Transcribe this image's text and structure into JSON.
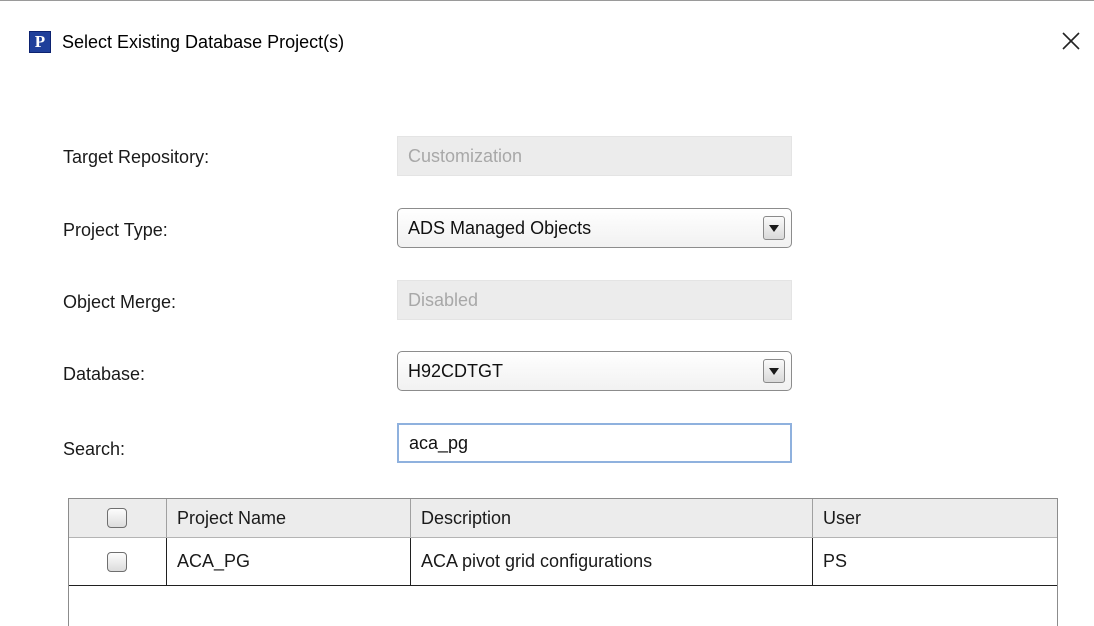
{
  "window": {
    "title": "Select Existing Database Project(s)",
    "icon_letter": "P",
    "icon_name": "peoplesoft-app-icon",
    "close_icon": "close-icon"
  },
  "form": {
    "target_repository": {
      "label": "Target Repository:",
      "value": "Customization"
    },
    "project_type": {
      "label": "Project Type:",
      "value": "ADS Managed Objects"
    },
    "object_merge": {
      "label": "Object Merge:",
      "value": "Disabled"
    },
    "database": {
      "label": "Database:",
      "value": "H92CDTGT"
    },
    "search": {
      "label": "Search:",
      "value": "aca_pg"
    }
  },
  "table": {
    "columns": [
      "",
      "Project Name",
      "Description",
      "User"
    ],
    "rows": [
      {
        "checked": false,
        "project_name": "ACA_PG",
        "description": "ACA pivot grid configurations",
        "user": "PS"
      }
    ]
  },
  "colors": {
    "icon_blue": "#1f3f9a",
    "input_focus_border": "#8fb1de",
    "disabled_bg": "#ececec",
    "disabled_text": "#a8a8a8"
  }
}
